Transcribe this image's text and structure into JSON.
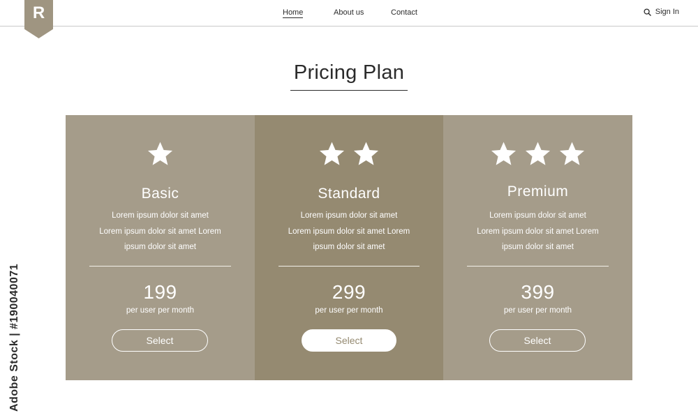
{
  "logo": {
    "letter": "R"
  },
  "nav": {
    "items": [
      {
        "label": "Home",
        "active": true
      },
      {
        "label": "About us",
        "active": false
      },
      {
        "label": "Contact",
        "active": false
      }
    ],
    "signin_label": "Sign In",
    "signin_icon": "search-icon"
  },
  "page": {
    "title": "Pricing Plan"
  },
  "plans": [
    {
      "name": "Basic",
      "stars": 1,
      "desc_lines": [
        "Lorem ipsum dolor sit amet",
        "Lorem ipsum dolor sit amet Lorem",
        "ipsum dolor sit amet"
      ],
      "price": "199",
      "period": "per user per month",
      "button": "Select",
      "highlighted": false
    },
    {
      "name": "Standard",
      "stars": 2,
      "desc_lines": [
        "Lorem ipsum dolor sit amet",
        "Lorem ipsum dolor sit amet Lorem",
        "ipsum dolor sit amet"
      ],
      "price": "299",
      "period": "per user per month",
      "button": "Select",
      "highlighted": true
    },
    {
      "name": "Premium",
      "stars": 3,
      "desc_lines": [
        "Lorem ipsum dolor sit amet",
        "Lorem ipsum dolor sit amet Lorem",
        "ipsum dolor sit amet"
      ],
      "price": "399",
      "period": "per user per month",
      "button": "Select",
      "highlighted": false
    }
  ],
  "watermark": {
    "side_text": "Adobe Stock | #190040071"
  },
  "colors": {
    "card": "#a59c8a",
    "card_highlight": "#958a71",
    "logo": "#9f9581",
    "text": "#2b2b2b"
  }
}
